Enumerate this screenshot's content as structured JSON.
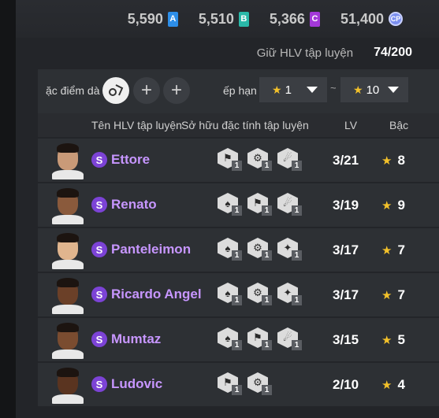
{
  "currencies": [
    {
      "amount": "5,590",
      "badge": "A",
      "color": "#2d8ee8"
    },
    {
      "amount": "5,510",
      "badge": "B",
      "color": "#2ab8a8"
    },
    {
      "amount": "5,366",
      "badge": "C",
      "color": "#a338d8"
    },
    {
      "amount": "51,400",
      "badge": "CP",
      "color": "#7b8ff0"
    }
  ],
  "coach_count": {
    "label": "Giữ HLV tập luyện",
    "value": "74/200"
  },
  "filters": {
    "trait_label": "ặc điểm dà",
    "rank_label": "ếp hạn",
    "rank_min": "1",
    "rank_max": "10",
    "tilde": "~",
    "add_symbol": "+"
  },
  "columns": {
    "name": "Tên HLV tập luyện",
    "traits": "Sở hữu đặc tính tập luyện",
    "lv": "LV",
    "rank": "Bậc"
  },
  "rows": [
    {
      "grade": "S",
      "name": "Ettore",
      "lv": "3/21",
      "rank": "8",
      "skin": "#c99a78",
      "traits": [
        {
          "icon": "⚑",
          "lvl": "1"
        },
        {
          "icon": "⚙",
          "lvl": "1"
        },
        {
          "icon": "☄",
          "lvl": "1"
        }
      ]
    },
    {
      "grade": "S",
      "name": "Renato",
      "lv": "3/19",
      "rank": "9",
      "skin": "#8a5a3c",
      "traits": [
        {
          "icon": "♠",
          "lvl": "1"
        },
        {
          "icon": "⚑",
          "lvl": "1"
        },
        {
          "icon": "☄",
          "lvl": "1"
        }
      ]
    },
    {
      "grade": "S",
      "name": "Panteleimon",
      "lv": "3/17",
      "rank": "7",
      "skin": "#e0b58e",
      "traits": [
        {
          "icon": "♠",
          "lvl": "1"
        },
        {
          "icon": "⚙",
          "lvl": "1"
        },
        {
          "icon": "✦",
          "lvl": "1"
        }
      ]
    },
    {
      "grade": "S",
      "name": "Ricardo Angel",
      "lv": "3/17",
      "rank": "7",
      "skin": "#6b4028",
      "traits": [
        {
          "icon": "♠",
          "lvl": "1"
        },
        {
          "icon": "⚙",
          "lvl": "1"
        },
        {
          "icon": "✦",
          "lvl": "1"
        }
      ]
    },
    {
      "grade": "S",
      "name": "Mumtaz",
      "lv": "3/15",
      "rank": "5",
      "skin": "#7a4c30",
      "traits": [
        {
          "icon": "♠",
          "lvl": "1"
        },
        {
          "icon": "⚑",
          "lvl": "1"
        },
        {
          "icon": "☄",
          "lvl": "1"
        }
      ]
    },
    {
      "grade": "S",
      "name": "Ludovic",
      "lv": "2/10",
      "rank": "4",
      "skin": "#5a3420",
      "traits": [
        {
          "icon": "⚑",
          "lvl": "1"
        },
        {
          "icon": "⚙",
          "lvl": "1"
        }
      ]
    }
  ]
}
